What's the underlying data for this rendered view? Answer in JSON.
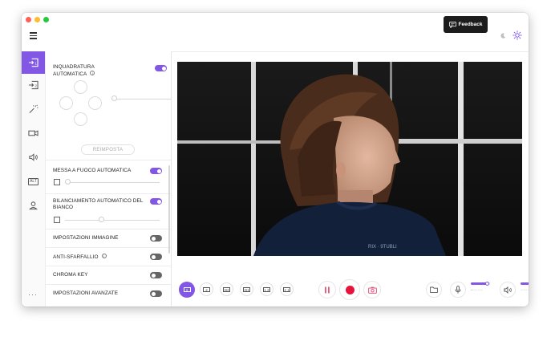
{
  "window": {
    "feedback_label": "Feedback",
    "accent_color": "#8257e6"
  },
  "icons": {
    "menu": "hamburger-icon",
    "feedback": "chat-bubble-icon",
    "theme_dark": "moon-icon",
    "theme_light": "sun-icon",
    "more": "ellipsis-icon"
  },
  "sidebar": {
    "items": [
      {
        "id": "source-1",
        "icon": "source-1-icon",
        "active": true
      },
      {
        "id": "source-2",
        "icon": "source-2-icon",
        "active": false
      },
      {
        "id": "effects",
        "icon": "magic-wand-icon",
        "active": false
      },
      {
        "id": "camera",
        "icon": "camera-icon",
        "active": false
      },
      {
        "id": "audio",
        "icon": "speaker-icon",
        "active": false
      },
      {
        "id": "alt",
        "icon": "alt-badge-icon",
        "label": "ALT",
        "active": false
      },
      {
        "id": "account",
        "icon": "user-icon",
        "active": false
      }
    ],
    "more_label": "···"
  },
  "panel": {
    "auto_framing": {
      "label": "INQUADRATURA AUTOMATICA",
      "enabled": true
    },
    "reset_label": "REIMPOSTA",
    "autofocus": {
      "label": "MESSA A FUOCO AUTOMATICA",
      "enabled": true
    },
    "white_balance": {
      "label": "BILANCIAMENTO AUTOMATICO DEL BIANCO",
      "enabled": true
    },
    "image_settings": {
      "label": "IMPOSTAZIONI IMMAGINE",
      "enabled": false
    },
    "anti_flicker": {
      "label": "ANTI-SFARFALLIO",
      "enabled": false
    },
    "chroma_key": {
      "label": "CHROMA KEY",
      "enabled": false
    },
    "advanced": {
      "label": "IMPOSTAZIONI AVANZATE",
      "enabled": false
    }
  },
  "bottombar": {
    "layouts": [
      {
        "id": "layout-1",
        "glyph": "1",
        "active": true
      },
      {
        "id": "layout-2",
        "glyph": "2",
        "active": false
      },
      {
        "id": "layout-3",
        "glyph": "⊡2",
        "active": false
      },
      {
        "id": "layout-4",
        "glyph": "⊡1",
        "active": false
      },
      {
        "id": "layout-5",
        "glyph": "1 2",
        "active": false
      },
      {
        "id": "layout-6",
        "glyph": "2 1",
        "active": false
      }
    ],
    "mic_level": 0.85,
    "speaker_level": 0.85
  }
}
